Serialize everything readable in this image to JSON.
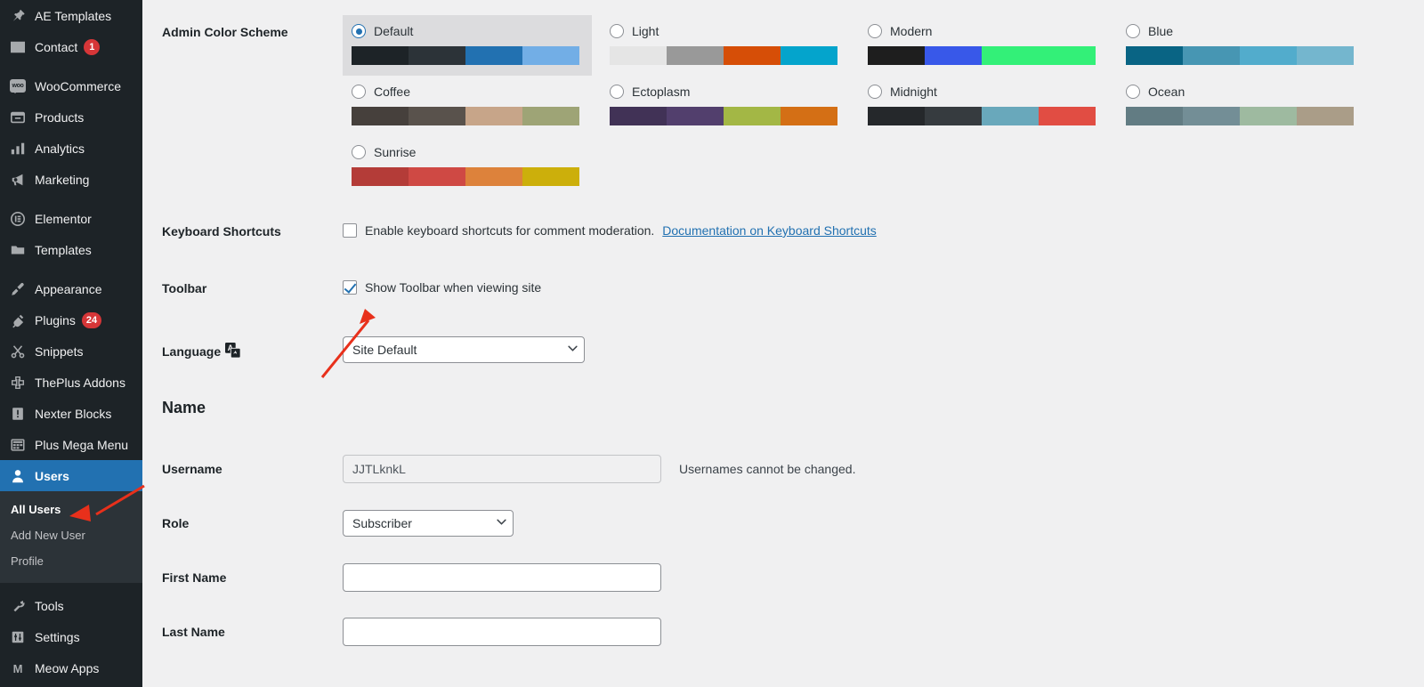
{
  "sidebar": {
    "items": [
      {
        "label": "AE Templates",
        "icon": "pin-icon",
        "badge": null,
        "active": false,
        "sep_before": false
      },
      {
        "label": "Contact",
        "icon": "mail-icon",
        "badge": "1",
        "active": false,
        "sep_before": false
      },
      {
        "label": "WooCommerce",
        "icon": "woo-icon",
        "badge": null,
        "active": false,
        "sep_before": true
      },
      {
        "label": "Products",
        "icon": "products-icon",
        "badge": null,
        "active": false,
        "sep_before": false
      },
      {
        "label": "Analytics",
        "icon": "chart-bars-icon",
        "badge": null,
        "active": false,
        "sep_before": false
      },
      {
        "label": "Marketing",
        "icon": "megaphone-icon",
        "badge": null,
        "active": false,
        "sep_before": false
      },
      {
        "label": "Elementor",
        "icon": "elementor-icon",
        "badge": null,
        "active": false,
        "sep_before": true
      },
      {
        "label": "Templates",
        "icon": "folder-icon",
        "badge": null,
        "active": false,
        "sep_before": false
      },
      {
        "label": "Appearance",
        "icon": "paintbrush-icon",
        "badge": null,
        "active": false,
        "sep_before": true
      },
      {
        "label": "Plugins",
        "icon": "plug-icon",
        "badge": "24",
        "active": false,
        "sep_before": false
      },
      {
        "label": "Snippets",
        "icon": "scissors-icon",
        "badge": null,
        "active": false,
        "sep_before": false
      },
      {
        "label": "ThePlus Addons",
        "icon": "theplus-icon",
        "badge": null,
        "active": false,
        "sep_before": false
      },
      {
        "label": "Nexter Blocks",
        "icon": "exclamation-box-icon",
        "badge": null,
        "active": false,
        "sep_before": false
      },
      {
        "label": "Plus Mega Menu",
        "icon": "mega-menu-icon",
        "badge": null,
        "active": false,
        "sep_before": false
      },
      {
        "label": "Users",
        "icon": "user-icon",
        "badge": null,
        "active": true,
        "sep_before": false
      }
    ],
    "submenu": [
      {
        "label": "All Users",
        "current": true
      },
      {
        "label": "Add New User",
        "current": false
      },
      {
        "label": "Profile",
        "current": false
      }
    ],
    "items_after": [
      {
        "label": "Tools",
        "icon": "wrench-icon",
        "badge": null,
        "active": false,
        "sep_before": true
      },
      {
        "label": "Settings",
        "icon": "sliders-icon",
        "badge": null,
        "active": false,
        "sep_before": false
      },
      {
        "label": "Meow Apps",
        "icon": "meow-icon",
        "badge": null,
        "active": false,
        "sep_before": false
      }
    ],
    "active_color": "#2271b1",
    "background": "#1d2327",
    "submenu_background": "#2c3338",
    "badge_color": "#d63638"
  },
  "profile": {
    "color_scheme": {
      "label": "Admin Color Scheme",
      "selected": "Default",
      "options": [
        {
          "name": "Default",
          "selected": true,
          "colors": [
            "#1d2327",
            "#2c3338",
            "#2271b1",
            "#72aee6"
          ]
        },
        {
          "name": "Light",
          "selected": false,
          "colors": [
            "#e5e5e5",
            "#999999",
            "#d64e07",
            "#04a4cc"
          ]
        },
        {
          "name": "Modern",
          "selected": false,
          "colors": [
            "#1e1e1e",
            "#3858e9",
            "#33f078",
            "#33f078"
          ]
        },
        {
          "name": "Blue",
          "selected": false,
          "colors": [
            "#096484",
            "#4796b3",
            "#52accc",
            "#74b6ce"
          ]
        },
        {
          "name": "Coffee",
          "selected": false,
          "colors": [
            "#46403c",
            "#59524c",
            "#c7a589",
            "#9ea476"
          ]
        },
        {
          "name": "Ectoplasm",
          "selected": false,
          "colors": [
            "#413256",
            "#523f6d",
            "#a3b745",
            "#d46f15"
          ]
        },
        {
          "name": "Midnight",
          "selected": false,
          "colors": [
            "#25282b",
            "#363b3f",
            "#69a8bb",
            "#e14d43"
          ]
        },
        {
          "name": "Ocean",
          "selected": false,
          "colors": [
            "#627c83",
            "#738e96",
            "#9ebaa0",
            "#aa9d88"
          ]
        },
        {
          "name": "Sunrise",
          "selected": false,
          "colors": [
            "#b43c38",
            "#cf4944",
            "#dd823b",
            "#ccaf0b"
          ]
        }
      ]
    },
    "keyboard_shortcuts": {
      "label": "Keyboard Shortcuts",
      "checkbox_label": "Enable keyboard shortcuts for comment moderation.",
      "checked": false,
      "doc_link": "Documentation on Keyboard Shortcuts"
    },
    "toolbar": {
      "label": "Toolbar",
      "checkbox_label": "Show Toolbar when viewing site",
      "checked": true
    },
    "language": {
      "label": "Language",
      "icon": "translate-icon",
      "value": "Site Default"
    },
    "name_section": {
      "title": "Name",
      "username": {
        "label": "Username",
        "value": "JJTLknkL",
        "hint": "Usernames cannot be changed."
      },
      "role": {
        "label": "Role",
        "value": "Subscriber"
      },
      "first_name": {
        "label": "First Name",
        "value": "",
        "placeholder": ""
      },
      "last_name": {
        "label": "Last Name",
        "value": "",
        "placeholder": ""
      }
    }
  },
  "annotations": {
    "arrow_color": "#e8301b",
    "arrow_toolbar_target": "toolbar-checkbox",
    "arrow_allusers_target": "sidebar-submenu-all-users"
  }
}
